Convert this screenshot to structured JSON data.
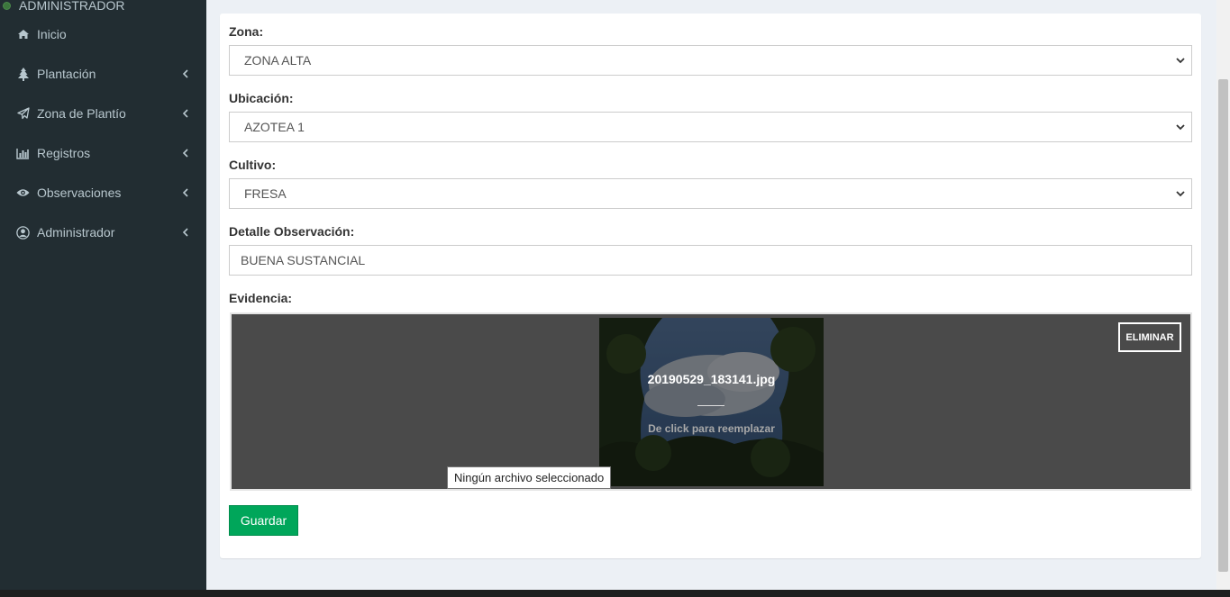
{
  "sidebar": {
    "user_status": "ADMINISTRADOR",
    "items": [
      {
        "label": "Inicio",
        "icon": "home-icon",
        "has_submenu": false
      },
      {
        "label": "Plantación",
        "icon": "tree-icon",
        "has_submenu": true
      },
      {
        "label": "Zona de Plantío",
        "icon": "paper-plane-icon",
        "has_submenu": true
      },
      {
        "label": "Registros",
        "icon": "bar-chart-icon",
        "has_submenu": true
      },
      {
        "label": "Observaciones",
        "icon": "eye-icon",
        "has_submenu": true
      },
      {
        "label": "Administrador",
        "icon": "user-circle-icon",
        "has_submenu": true
      }
    ]
  },
  "form": {
    "zona_label": "Zona:",
    "zona_value": "ZONA ALTA",
    "ubicacion_label": "Ubicación:",
    "ubicacion_value": "AZOTEA 1",
    "cultivo_label": "Cultivo:",
    "cultivo_value": "FRESA",
    "detalle_label": "Detalle Observación:",
    "detalle_value": "BUENA SUSTANCIAL",
    "evidencia_label": "Evidencia:",
    "evidencia": {
      "filename": "20190529_183141.jpg",
      "replace_hint": "De click para reemplazar",
      "remove_label": "ELIMINAR",
      "file_tooltip": "Ningún archivo seleccionado"
    },
    "save_label": "Guardar"
  },
  "colors": {
    "sidebar_bg": "#222d32",
    "sidebar_text": "#b8c7ce",
    "page_bg": "#ecf0f5",
    "save_button": "#00a65a",
    "dropzone_bg": "#4a4a4a"
  }
}
